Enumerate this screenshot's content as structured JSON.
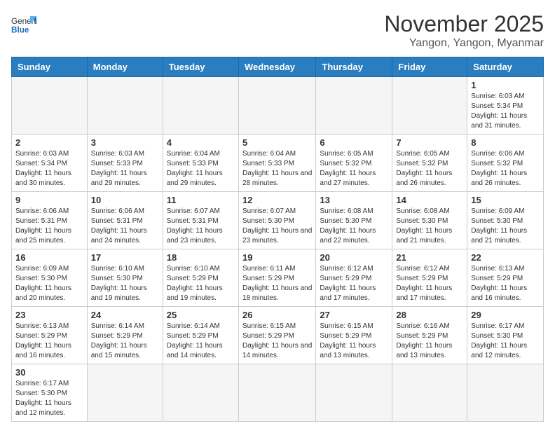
{
  "header": {
    "logo_general": "General",
    "logo_blue": "Blue",
    "month_year": "November 2025",
    "location": "Yangon, Yangon, Myanmar"
  },
  "weekdays": [
    "Sunday",
    "Monday",
    "Tuesday",
    "Wednesday",
    "Thursday",
    "Friday",
    "Saturday"
  ],
  "weeks": [
    [
      {
        "day": "",
        "info": "",
        "empty": true
      },
      {
        "day": "",
        "info": "",
        "empty": true
      },
      {
        "day": "",
        "info": "",
        "empty": true
      },
      {
        "day": "",
        "info": "",
        "empty": true
      },
      {
        "day": "",
        "info": "",
        "empty": true
      },
      {
        "day": "",
        "info": "",
        "empty": true
      },
      {
        "day": "1",
        "info": "Sunrise: 6:03 AM\nSunset: 5:34 PM\nDaylight: 11 hours\nand 31 minutes.",
        "empty": false
      }
    ],
    [
      {
        "day": "2",
        "info": "Sunrise: 6:03 AM\nSunset: 5:34 PM\nDaylight: 11 hours\nand 30 minutes.",
        "empty": false
      },
      {
        "day": "3",
        "info": "Sunrise: 6:03 AM\nSunset: 5:33 PM\nDaylight: 11 hours\nand 29 minutes.",
        "empty": false
      },
      {
        "day": "4",
        "info": "Sunrise: 6:04 AM\nSunset: 5:33 PM\nDaylight: 11 hours\nand 29 minutes.",
        "empty": false
      },
      {
        "day": "5",
        "info": "Sunrise: 6:04 AM\nSunset: 5:33 PM\nDaylight: 11 hours\nand 28 minutes.",
        "empty": false
      },
      {
        "day": "6",
        "info": "Sunrise: 6:05 AM\nSunset: 5:32 PM\nDaylight: 11 hours\nand 27 minutes.",
        "empty": false
      },
      {
        "day": "7",
        "info": "Sunrise: 6:05 AM\nSunset: 5:32 PM\nDaylight: 11 hours\nand 26 minutes.",
        "empty": false
      },
      {
        "day": "8",
        "info": "Sunrise: 6:06 AM\nSunset: 5:32 PM\nDaylight: 11 hours\nand 26 minutes.",
        "empty": false
      }
    ],
    [
      {
        "day": "9",
        "info": "Sunrise: 6:06 AM\nSunset: 5:31 PM\nDaylight: 11 hours\nand 25 minutes.",
        "empty": false
      },
      {
        "day": "10",
        "info": "Sunrise: 6:06 AM\nSunset: 5:31 PM\nDaylight: 11 hours\nand 24 minutes.",
        "empty": false
      },
      {
        "day": "11",
        "info": "Sunrise: 6:07 AM\nSunset: 5:31 PM\nDaylight: 11 hours\nand 23 minutes.",
        "empty": false
      },
      {
        "day": "12",
        "info": "Sunrise: 6:07 AM\nSunset: 5:30 PM\nDaylight: 11 hours\nand 23 minutes.",
        "empty": false
      },
      {
        "day": "13",
        "info": "Sunrise: 6:08 AM\nSunset: 5:30 PM\nDaylight: 11 hours\nand 22 minutes.",
        "empty": false
      },
      {
        "day": "14",
        "info": "Sunrise: 6:08 AM\nSunset: 5:30 PM\nDaylight: 11 hours\nand 21 minutes.",
        "empty": false
      },
      {
        "day": "15",
        "info": "Sunrise: 6:09 AM\nSunset: 5:30 PM\nDaylight: 11 hours\nand 21 minutes.",
        "empty": false
      }
    ],
    [
      {
        "day": "16",
        "info": "Sunrise: 6:09 AM\nSunset: 5:30 PM\nDaylight: 11 hours\nand 20 minutes.",
        "empty": false
      },
      {
        "day": "17",
        "info": "Sunrise: 6:10 AM\nSunset: 5:30 PM\nDaylight: 11 hours\nand 19 minutes.",
        "empty": false
      },
      {
        "day": "18",
        "info": "Sunrise: 6:10 AM\nSunset: 5:29 PM\nDaylight: 11 hours\nand 19 minutes.",
        "empty": false
      },
      {
        "day": "19",
        "info": "Sunrise: 6:11 AM\nSunset: 5:29 PM\nDaylight: 11 hours\nand 18 minutes.",
        "empty": false
      },
      {
        "day": "20",
        "info": "Sunrise: 6:12 AM\nSunset: 5:29 PM\nDaylight: 11 hours\nand 17 minutes.",
        "empty": false
      },
      {
        "day": "21",
        "info": "Sunrise: 6:12 AM\nSunset: 5:29 PM\nDaylight: 11 hours\nand 17 minutes.",
        "empty": false
      },
      {
        "day": "22",
        "info": "Sunrise: 6:13 AM\nSunset: 5:29 PM\nDaylight: 11 hours\nand 16 minutes.",
        "empty": false
      }
    ],
    [
      {
        "day": "23",
        "info": "Sunrise: 6:13 AM\nSunset: 5:29 PM\nDaylight: 11 hours\nand 16 minutes.",
        "empty": false
      },
      {
        "day": "24",
        "info": "Sunrise: 6:14 AM\nSunset: 5:29 PM\nDaylight: 11 hours\nand 15 minutes.",
        "empty": false
      },
      {
        "day": "25",
        "info": "Sunrise: 6:14 AM\nSunset: 5:29 PM\nDaylight: 11 hours\nand 14 minutes.",
        "empty": false
      },
      {
        "day": "26",
        "info": "Sunrise: 6:15 AM\nSunset: 5:29 PM\nDaylight: 11 hours\nand 14 minutes.",
        "empty": false
      },
      {
        "day": "27",
        "info": "Sunrise: 6:15 AM\nSunset: 5:29 PM\nDaylight: 11 hours\nand 13 minutes.",
        "empty": false
      },
      {
        "day": "28",
        "info": "Sunrise: 6:16 AM\nSunset: 5:29 PM\nDaylight: 11 hours\nand 13 minutes.",
        "empty": false
      },
      {
        "day": "29",
        "info": "Sunrise: 6:17 AM\nSunset: 5:30 PM\nDaylight: 11 hours\nand 12 minutes.",
        "empty": false
      }
    ],
    [
      {
        "day": "30",
        "info": "Sunrise: 6:17 AM\nSunset: 5:30 PM\nDaylight: 11 hours\nand 12 minutes.",
        "empty": false,
        "last": true
      },
      {
        "day": "",
        "info": "",
        "empty": true,
        "last": true
      },
      {
        "day": "",
        "info": "",
        "empty": true,
        "last": true
      },
      {
        "day": "",
        "info": "",
        "empty": true,
        "last": true
      },
      {
        "day": "",
        "info": "",
        "empty": true,
        "last": true
      },
      {
        "day": "",
        "info": "",
        "empty": true,
        "last": true
      },
      {
        "day": "",
        "info": "",
        "empty": true,
        "last": true
      }
    ]
  ]
}
